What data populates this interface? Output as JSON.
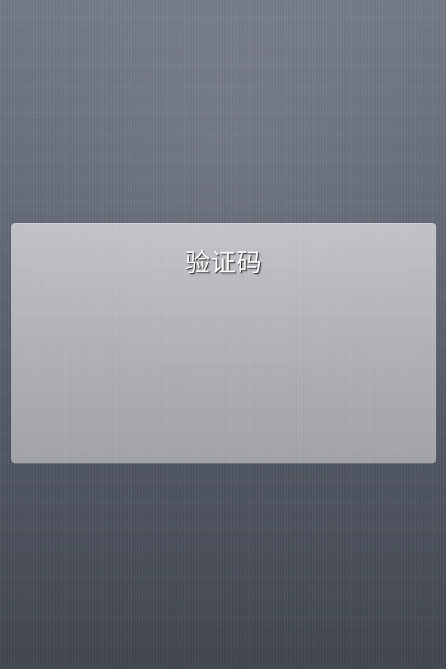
{
  "dialog": {
    "title": "验证码"
  }
}
